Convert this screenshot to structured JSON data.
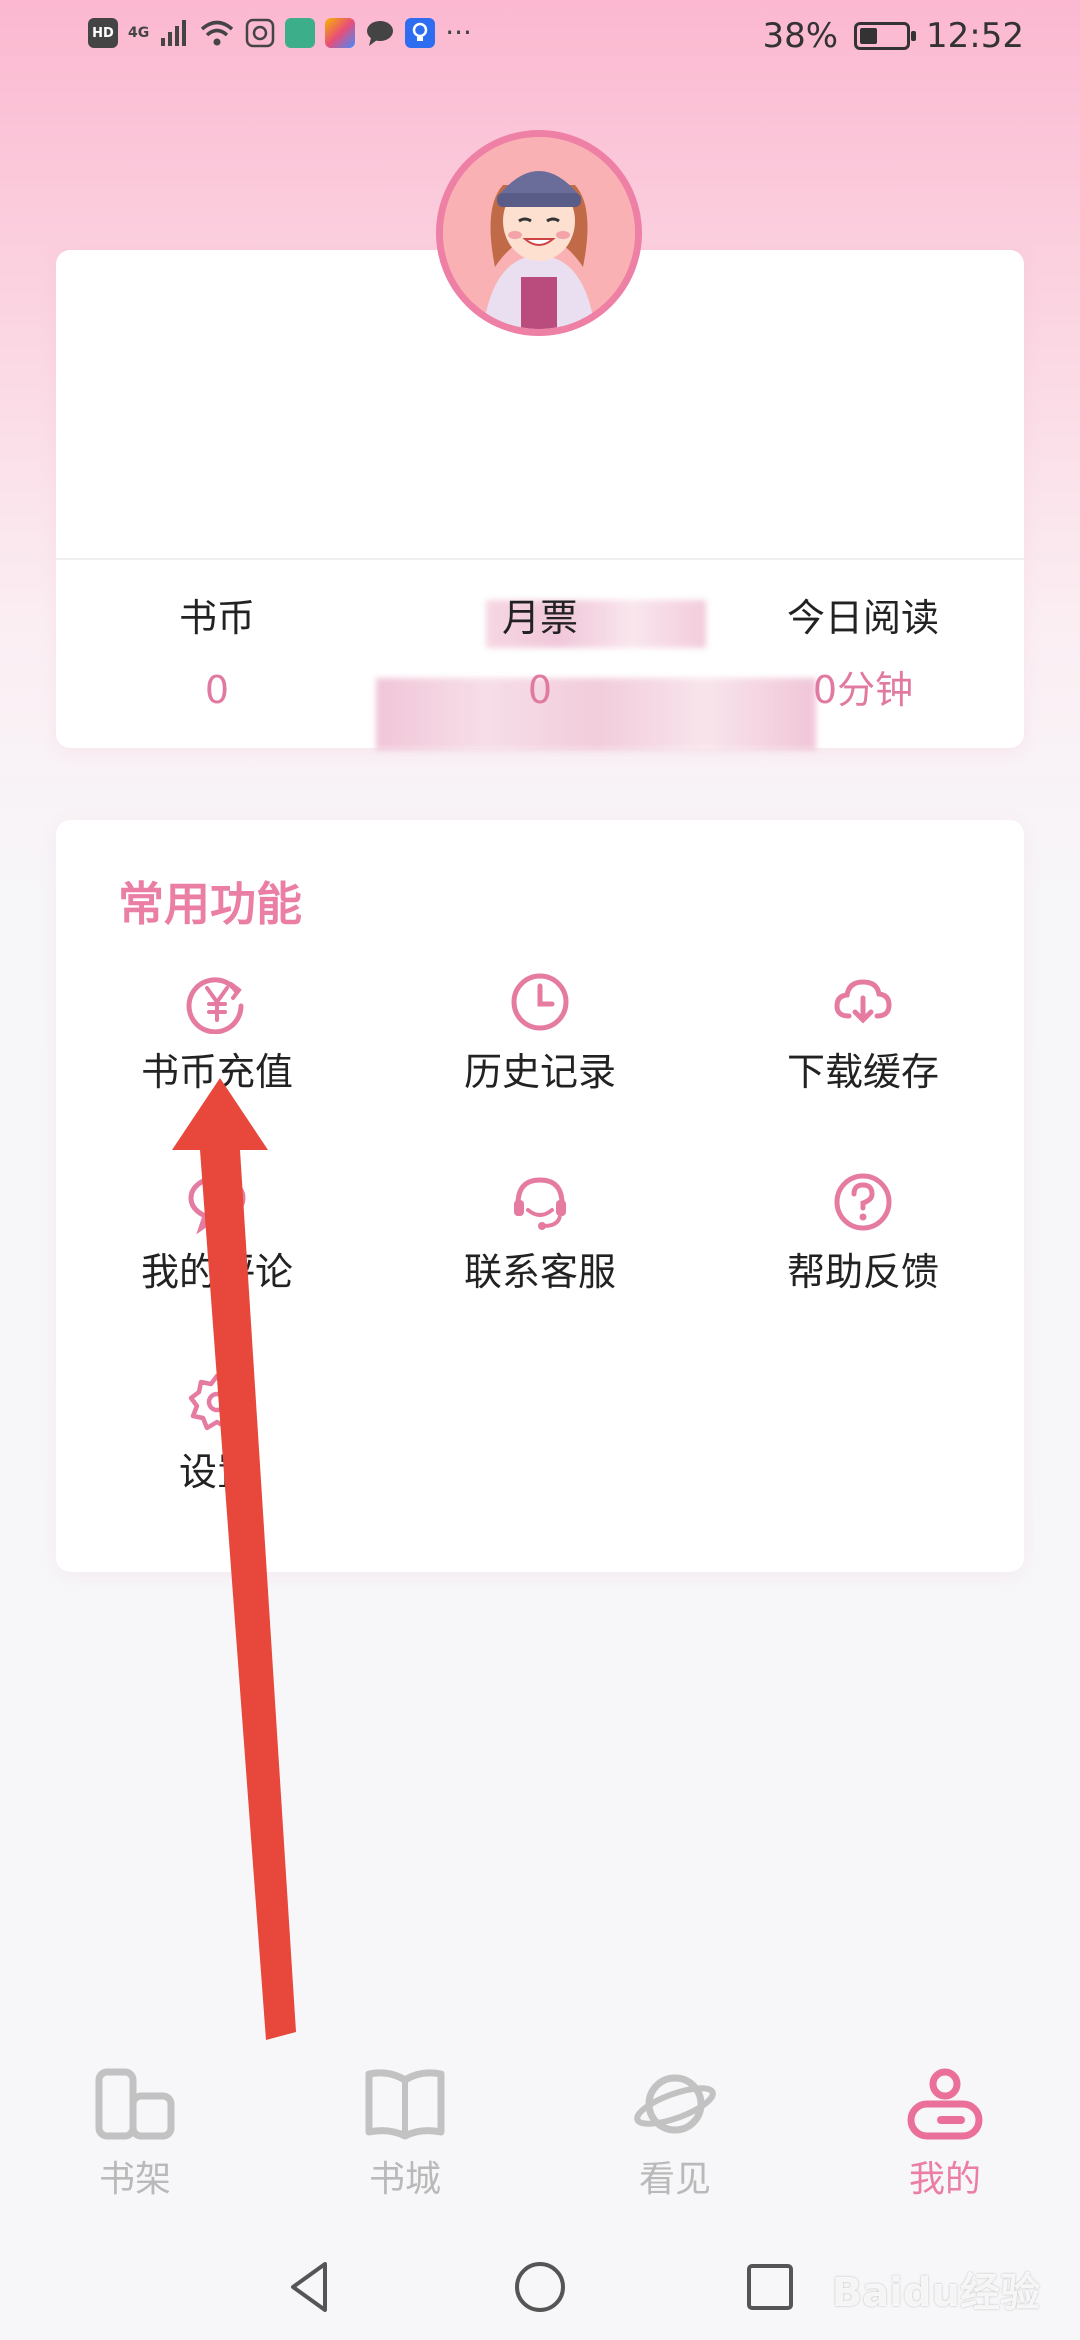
{
  "status_bar": {
    "network": "4G",
    "battery_percent": "38%",
    "battery_level": 0.38,
    "time": "12:52"
  },
  "profile": {
    "stats": [
      {
        "label": "书币",
        "value": "0"
      },
      {
        "label": "月票",
        "value": "0"
      },
      {
        "label": "今日阅读",
        "value": "0分钟"
      }
    ]
  },
  "functions": {
    "title": "常用功能",
    "items": [
      {
        "label": "书币充值",
        "icon": "coin-recharge-icon"
      },
      {
        "label": "历史记录",
        "icon": "clock-icon"
      },
      {
        "label": "下载缓存",
        "icon": "cloud-download-icon"
      },
      {
        "label": "我的评论",
        "icon": "comment-icon"
      },
      {
        "label": "联系客服",
        "icon": "headset-icon"
      },
      {
        "label": "帮助反馈",
        "icon": "question-icon"
      },
      {
        "label": "设置",
        "icon": "gear-icon"
      }
    ]
  },
  "tabs": [
    {
      "label": "书架",
      "icon": "bookshelf-icon",
      "active": false
    },
    {
      "label": "书城",
      "icon": "open-book-icon",
      "active": false
    },
    {
      "label": "看见",
      "icon": "planet-icon",
      "active": false
    },
    {
      "label": "我的",
      "icon": "profile-icon",
      "active": true
    }
  ],
  "colors": {
    "accent": "#ea7ea4",
    "inactive": "#b9b9b9"
  },
  "watermark": "Baidu经验"
}
